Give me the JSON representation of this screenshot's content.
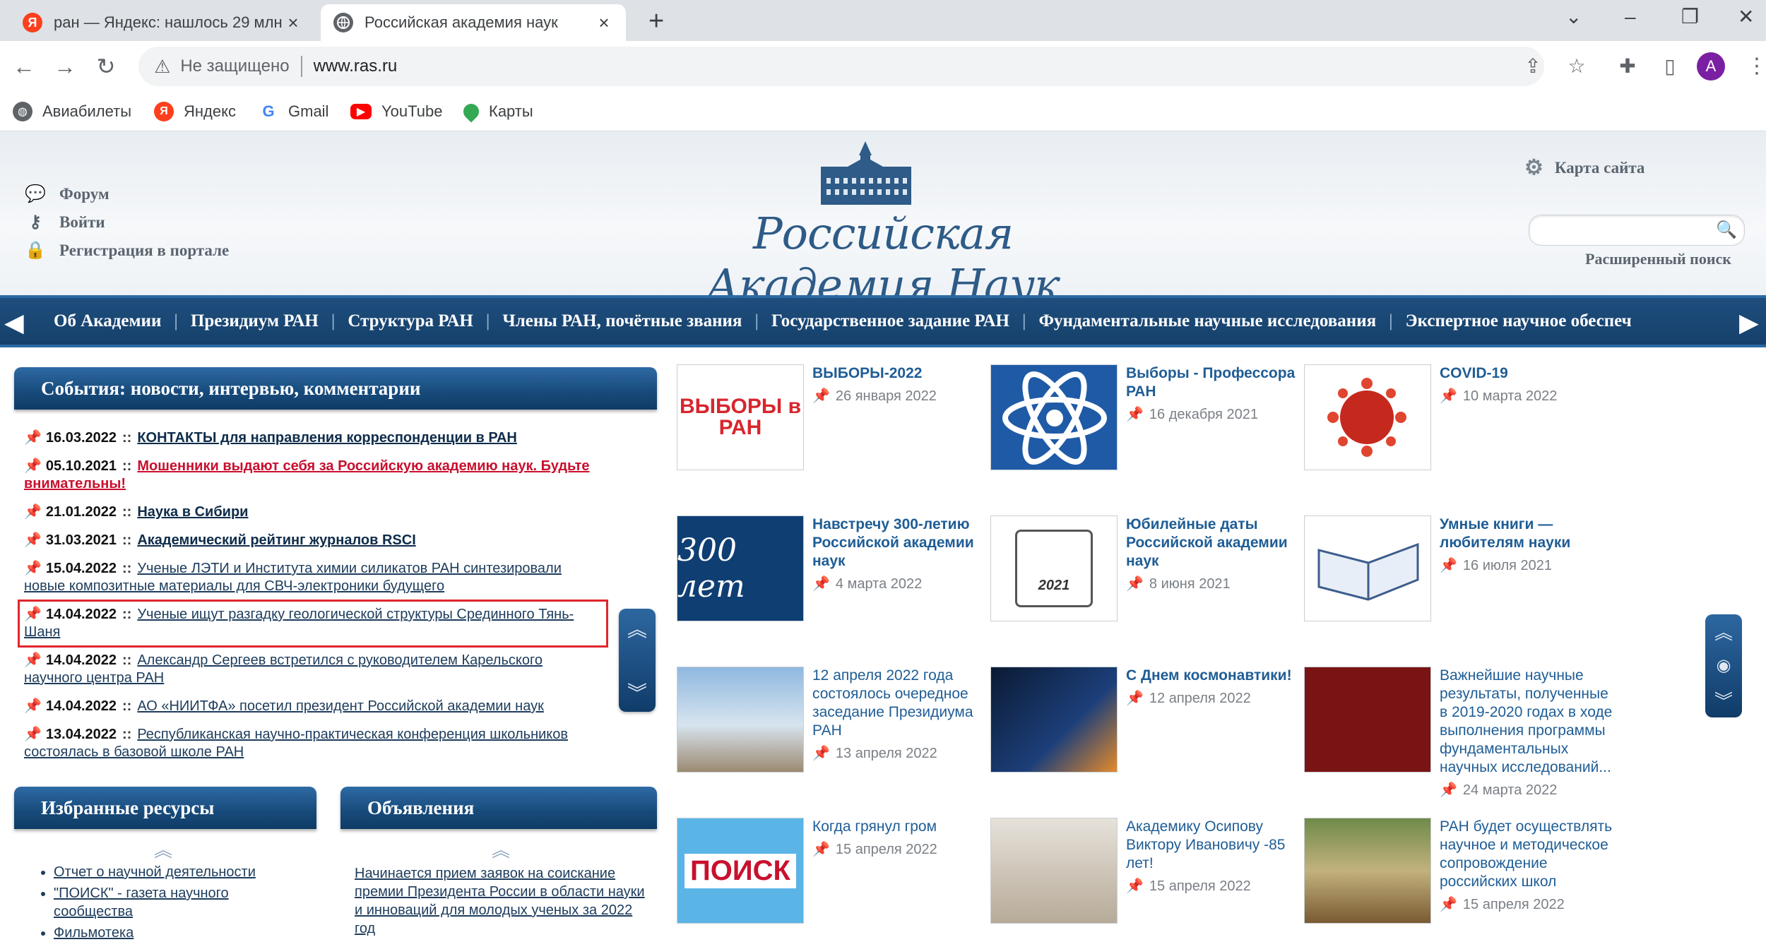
{
  "browser": {
    "tabs": [
      {
        "title": "ран — Яндекс: нашлось 29 млн",
        "favicon": "yandex-icon"
      },
      {
        "title": "Российская академия наук",
        "favicon": "globe-icon"
      }
    ],
    "address": {
      "security_label": "Не защищено",
      "url": "www.ras.ru"
    },
    "profile_initial": "A",
    "bookmarks": [
      {
        "label": "Авиабилеты",
        "icon": "globe-icon"
      },
      {
        "label": "Яндекс",
        "icon": "yandex-icon"
      },
      {
        "label": "Gmail",
        "icon": "google-icon"
      },
      {
        "label": "YouTube",
        "icon": "youtube-icon"
      },
      {
        "label": "Карты",
        "icon": "maps-pin-icon"
      }
    ]
  },
  "site": {
    "util_links": {
      "forum": "Форум",
      "login": "Войти",
      "register": "Регистрация в портале"
    },
    "logo_text": "Российская Академия Наук",
    "sitemap": "Карта сайта",
    "advanced_search": "Расширенный поиск",
    "nav": [
      "Об Академии",
      "Президиум РАН",
      "Структура РАН",
      "Члены РАН, почётные звания",
      "Государственное задание РАН",
      "Фундаментальные научные исследования",
      "Экспертное научное обеспеч"
    ],
    "events": {
      "heading": "События: новости, интервью, комментарии",
      "items": [
        {
          "date": "16.03.2022",
          "text": "КОНТАКТЫ для направления корреспонденции в РАН"
        },
        {
          "date": "05.10.2021",
          "text": "Мошенники выдают себя за Российскую академию наук. Будьте внимательны!"
        },
        {
          "date": "21.01.2022",
          "text": "Наука в Сибири"
        },
        {
          "date": "31.03.2021",
          "text": "Академический рейтинг журналов RSCI"
        },
        {
          "date": "15.04.2022",
          "text": "Ученые ЛЭТИ и Института химии силикатов РАН синтезировали новые композитные материалы для СВЧ-электроники будущего"
        },
        {
          "date": "14.04.2022",
          "text": "Ученые ищут разгадку геологической структуры Срединного Тянь-Шаня"
        },
        {
          "date": "14.04.2022",
          "text": "Александр Сергеев встретился с руководителем Карельского научного центра РАН"
        },
        {
          "date": "14.04.2022",
          "text": "АО «НИИТФА» посетил президент Российской академии наук"
        },
        {
          "date": "13.04.2022",
          "text": "Республиканская научно-практическая конференция школьников состоялась в базовой школе РАН"
        }
      ]
    },
    "resources": {
      "heading": "Избранные ресурсы",
      "items": [
        "Отчет о научной деятельности",
        "\"ПОИСК\" - газета научного сообщества",
        "Фильмотека"
      ]
    },
    "announcements": {
      "heading": "Объявления",
      "text": "Начинается прием заявок на соискание премии Президента России в области науки и инноваций для молодых ученых за 2022 год"
    },
    "tiles": [
      {
        "title": "ВЫБОРЫ-2022",
        "date": "26 января 2022",
        "img_text": "ВЫБОРЫ в РАН"
      },
      {
        "title": "Выборы - Профессора РАН",
        "date": "16 декабря 2021"
      },
      {
        "title": "COVID-19",
        "date": "10 марта 2022"
      },
      {
        "title": "Навстречу 300-летию Российской академии наук",
        "date": "4 марта 2022",
        "img_text": "300 лет"
      },
      {
        "title": "Юбилейные даты Российской академии наук",
        "date": "8 июня 2021",
        "img_text": "2021"
      },
      {
        "title": "Умные книги — любителям науки",
        "date": "16 июля 2021"
      },
      {
        "title": "12 апреля 2022 года состоялось очередное заседание Президиума РАН",
        "date": "13 апреля 2022"
      },
      {
        "title": "С Днем космонавтики!",
        "date": "12 апреля 2022"
      },
      {
        "title": "Важнейшие научные результаты, полученные в 2019-2020 годах в ходе выполнения программы фундаментальных научных исследований...",
        "date": "24 марта 2022"
      },
      {
        "title": "Когда грянул гром",
        "date": "15 апреля 2022",
        "img_text": "ПОИСК"
      },
      {
        "title": "Академику Осипову Виктору Ивановичу -85 лет!",
        "date": "15 апреля 2022"
      },
      {
        "title": "РАН будет осуществлять научное и методическое сопровождение российских школ",
        "date": "15 апреля 2022"
      }
    ]
  }
}
